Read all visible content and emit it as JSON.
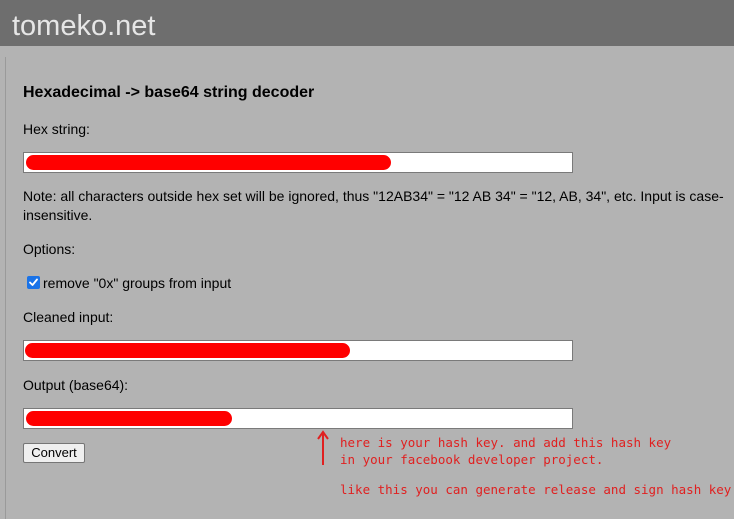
{
  "header": {
    "site_title": "tomeko.net"
  },
  "page": {
    "heading": "Hexadecimal -> base64 string decoder",
    "hex_label": "Hex string:",
    "note": "Note: all characters outside hex set will be ignored, thus \"12AB34\" = \"12 AB 34\" = \"12, AB, 34\", etc. Input is case-insensitive.",
    "options_label": "Options:",
    "remove_0x_label": "remove \"0x\" groups from input",
    "remove_0x_checked": true,
    "cleaned_label": "Cleaned input:",
    "output_label": "Output (base64):",
    "convert_label": "Convert"
  },
  "annotation": {
    "line1": "here is your hash key. and add this hash key",
    "line2": "in your facebook developer project.",
    "line3": "like this you can generate release and sign hash key.",
    "color": "#e02020"
  },
  "redaction_color": "#ff0000"
}
